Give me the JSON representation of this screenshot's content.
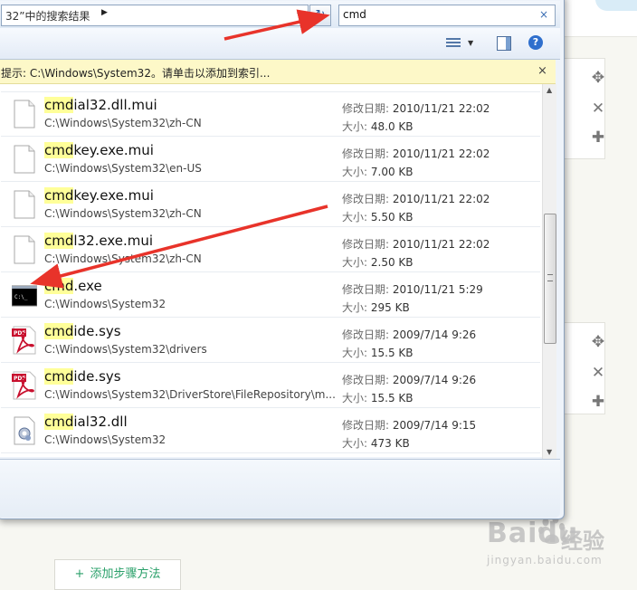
{
  "window": {
    "address_text": "32”中的搜索结果",
    "search_value": "cmd",
    "search_clear": "×",
    "refresh_glyph": "↻",
    "help_glyph": "?",
    "infobar_text": "提示: C:\\Windows\\System32。请单击以添加到索引...",
    "infobar_close": "×"
  },
  "results": [
    {
      "highlight": "cmd",
      "rest": "ial32.dll.mui",
      "path": "C:\\Windows\\System32\\zh-CN",
      "date_label": "修改日期:",
      "date": "2010/11/21 22:02",
      "size_label": "大小:",
      "size": "48.0 KB",
      "icon": "document-icon"
    },
    {
      "highlight": "cmd",
      "rest": "key.exe.mui",
      "path": "C:\\Windows\\System32\\en-US",
      "date_label": "修改日期:",
      "date": "2010/11/21 22:02",
      "size_label": "大小:",
      "size": "7.00 KB",
      "icon": "document-icon"
    },
    {
      "highlight": "cmd",
      "rest": "key.exe.mui",
      "path": "C:\\Windows\\System32\\zh-CN",
      "date_label": "修改日期:",
      "date": "2010/11/21 22:02",
      "size_label": "大小:",
      "size": "5.50 KB",
      "icon": "document-icon"
    },
    {
      "highlight": "cmd",
      "rest": "l32.exe.mui",
      "path": "C:\\Windows\\System32\\zh-CN",
      "date_label": "修改日期:",
      "date": "2010/11/21 22:02",
      "size_label": "大小:",
      "size": "2.50 KB",
      "icon": "document-icon"
    },
    {
      "highlight": "cmd",
      "rest": ".exe",
      "path": "C:\\Windows\\System32",
      "date_label": "修改日期:",
      "date": "2010/11/21 5:29",
      "size_label": "大小:",
      "size": "295 KB",
      "icon": "console-icon"
    },
    {
      "highlight": "cmd",
      "rest": "ide.sys",
      "path": "C:\\Windows\\System32\\drivers",
      "date_label": "修改日期:",
      "date": "2009/7/14 9:26",
      "size_label": "大小:",
      "size": "15.5 KB",
      "icon": "pdf-icon"
    },
    {
      "highlight": "cmd",
      "rest": "ide.sys",
      "path": "C:\\Windows\\System32\\DriverStore\\FileRepository\\m...",
      "date_label": "修改日期:",
      "date": "2009/7/14 9:26",
      "size_label": "大小:",
      "size": "15.5 KB",
      "icon": "pdf-icon"
    },
    {
      "highlight": "cmd",
      "rest": "ial32.dll",
      "path": "C:\\Windows\\System32",
      "date_label": "修改日期:",
      "date": "2009/7/14 9:15",
      "size_label": "大小:",
      "size": "473 KB",
      "icon": "settings-file-icon"
    }
  ],
  "console_icon_text": "C:\\_",
  "pdf_icon_text": "PDF",
  "page": {
    "add_step_plus": "+",
    "add_step_label": "添加步骤方法",
    "watermark_logo": "Baidu",
    "watermark_cn": "经验",
    "watermark_url": "jingyan.baidu.com"
  },
  "colors": {
    "highlight": "#ffff99",
    "arrow": "#e8332a",
    "accent_green": "#2aa06a"
  }
}
